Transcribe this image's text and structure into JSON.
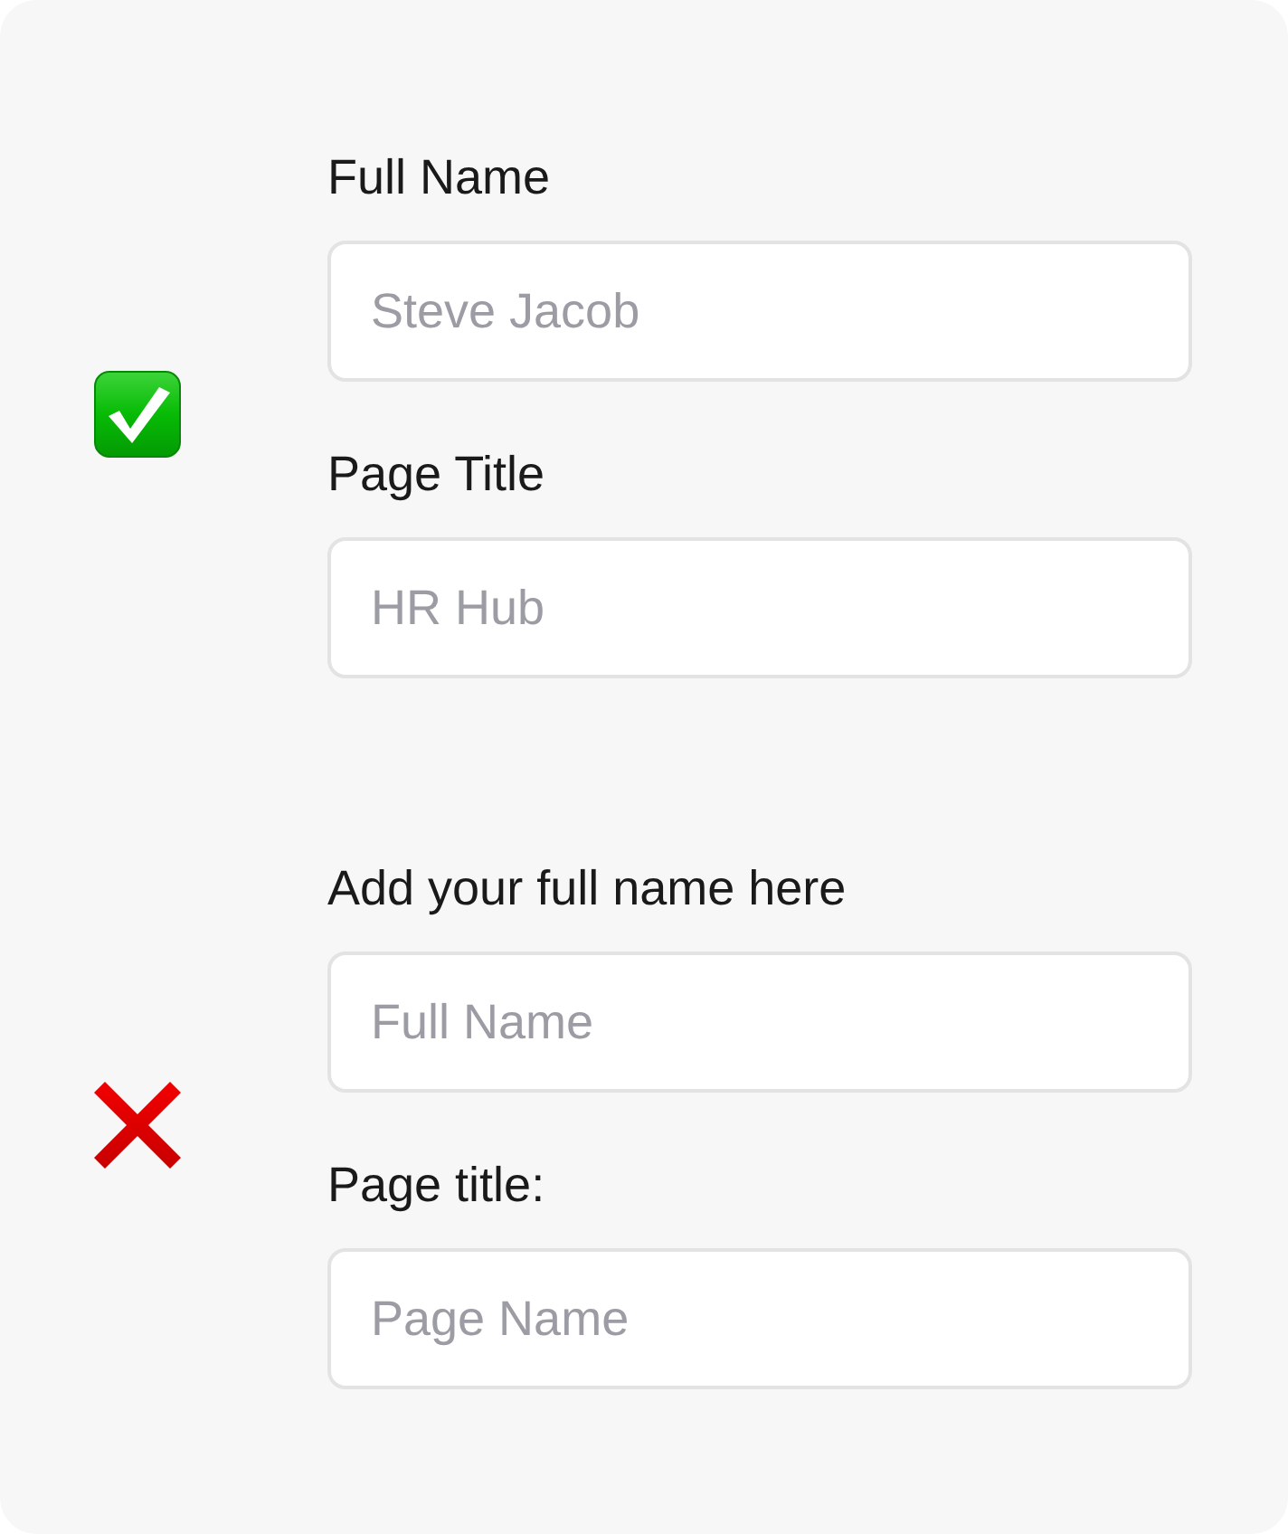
{
  "examples": [
    {
      "kind": "correct",
      "fields": [
        {
          "label": "Full Name",
          "placeholder": "Steve Jacob"
        },
        {
          "label": "Page Title",
          "placeholder": "HR Hub"
        }
      ]
    },
    {
      "kind": "incorrect",
      "fields": [
        {
          "label": "Add your full name here",
          "placeholder": "Full Name"
        },
        {
          "label": "Page title:",
          "placeholder": "Page Name"
        }
      ]
    }
  ]
}
